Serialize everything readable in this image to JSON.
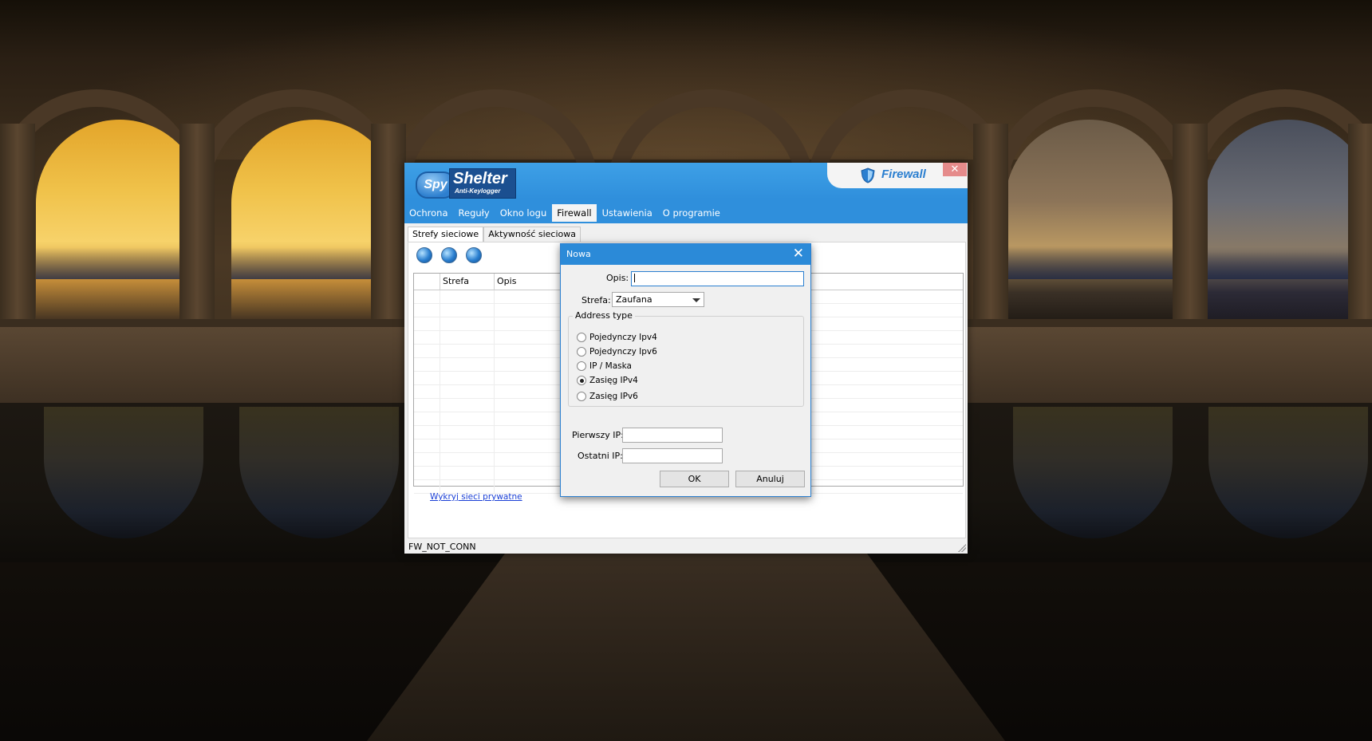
{
  "app": {
    "logo_spy": "Spy",
    "logo_shelter": "Shelter",
    "logo_sub": "Anti-Keylogger",
    "section_title": "Firewall",
    "close_glyph": "✕",
    "menu": [
      {
        "label": "Ochrona"
      },
      {
        "label": "Reguły"
      },
      {
        "label": "Okno logu"
      },
      {
        "label": "Firewall"
      },
      {
        "label": "Ustawienia"
      },
      {
        "label": "O programie"
      }
    ],
    "active_menu": "Firewall",
    "tabs": [
      {
        "label": "Strefy sieciowe"
      },
      {
        "label": "Aktywność sieciowa"
      }
    ],
    "toolbar_icons": [
      "globe-add-icon",
      "globe-edit-icon",
      "globe-remove-icon"
    ],
    "grid": {
      "columns": [
        "",
        "Strefa",
        "Opis"
      ],
      "rows": []
    },
    "link_text": "Wykryj sieci prywatne",
    "status_text": "FW_NOT_CONN",
    "accent_color": "#2f8fdc"
  },
  "dialog": {
    "title": "Nowa",
    "close_glyph": "✕",
    "opis_label": "Opis:",
    "opis_value": "",
    "strefa_label": "Strefa:",
    "strefa_value": "Zaufana",
    "address_group_label": "Address type",
    "address_options": [
      {
        "label": "Pojedynczy Ipv4",
        "checked": false
      },
      {
        "label": "Pojedynczy Ipv6",
        "checked": false
      },
      {
        "label": "IP / Maska",
        "checked": false
      },
      {
        "label": "Zasięg IPv4",
        "checked": true
      },
      {
        "label": "Zasięg IPv6",
        "checked": false
      }
    ],
    "first_ip_label": "Pierwszy IP:",
    "first_ip_value": "",
    "last_ip_label": "Ostatni IP:",
    "last_ip_value": "",
    "ok_label": "OK",
    "cancel_label": "Anuluj"
  }
}
